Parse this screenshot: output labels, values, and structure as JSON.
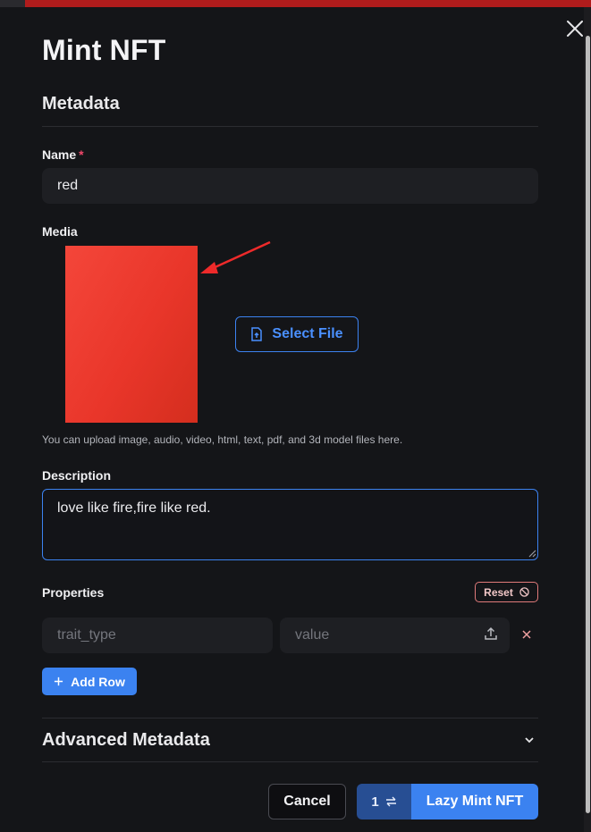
{
  "modal": {
    "title": "Mint NFT",
    "section_title": "Metadata"
  },
  "name_field": {
    "label": "Name",
    "required_mark": "*",
    "value": "red"
  },
  "media": {
    "label": "Media",
    "select_file_label": "Select File",
    "hint": "You can upload image, audio, video, html, text, pdf, and 3d model files here.",
    "preview_color": "#e9362a"
  },
  "description": {
    "label": "Description",
    "value": "love like fire,fire like red."
  },
  "properties": {
    "label": "Properties",
    "reset_label": "Reset",
    "rows": [
      {
        "trait_type_placeholder": "trait_type",
        "value_placeholder": "value"
      }
    ],
    "add_row_label": "Add Row"
  },
  "advanced": {
    "label": "Advanced Metadata"
  },
  "footer": {
    "cancel_label": "Cancel",
    "network_count": "1",
    "mint_label": "Lazy Mint NFT"
  },
  "colors": {
    "accent": "#3b82f0",
    "required": "#f0476a",
    "reset_border": "#e07a7a",
    "topbar": "#b01c1c"
  },
  "icons": {
    "close": "close-icon",
    "file": "file-upload-icon",
    "reset": "ban-icon",
    "upload": "upload-icon",
    "remove": "close-icon",
    "add": "plus-icon",
    "chevron": "chevron-down-icon",
    "switch": "switch-arrows-icon"
  }
}
